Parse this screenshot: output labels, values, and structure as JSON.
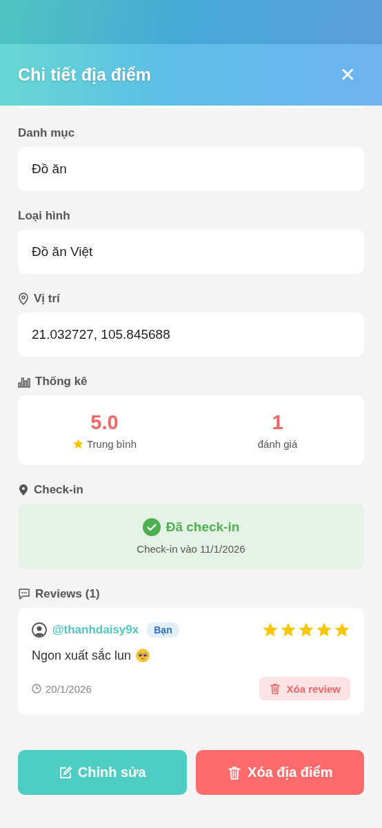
{
  "header": {
    "title": "Chi tiết địa điểm",
    "close": "✕"
  },
  "fields": [
    {
      "kind": "plain",
      "label": "Danh mục",
      "value": "Đồ ăn"
    },
    {
      "kind": "plain",
      "label": "Loại hình",
      "value": "Đồ ăn Việt"
    },
    {
      "kind": "location",
      "label": "Vị trí",
      "value": "21.032727, 105.845688"
    }
  ],
  "stats": {
    "label": "Thống kê",
    "average": "5.0",
    "average_label": "Trung bình",
    "count": "1",
    "count_label": "đánh giá"
  },
  "checkin": {
    "label": "Check-in",
    "checked_in": true,
    "status": "Đã check-in",
    "date": "Check-in vào 11/1/2026"
  },
  "reviews": {
    "label": "Reviews (1)",
    "items": [
      {
        "user": "@thanhdaisy9x",
        "badge": "Bạn",
        "stars": 5,
        "text": "Ngon xuất sắc lun",
        "date": "20/1/2026",
        "delete": "Xóa review"
      }
    ]
  },
  "buttons": [
    {
      "kind": "edit",
      "label": "Chỉnh sửa"
    },
    {
      "kind": "delete",
      "label": "Xóa địa điểm"
    }
  ]
}
